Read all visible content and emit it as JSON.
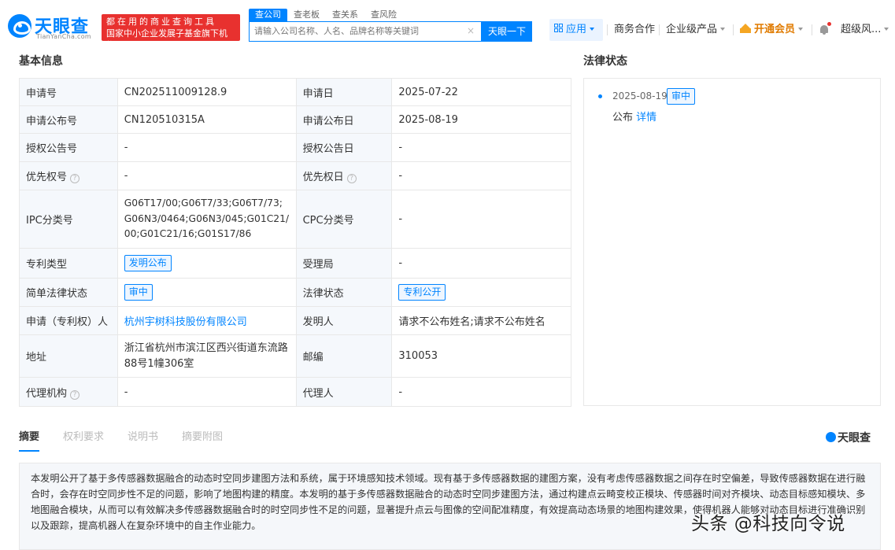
{
  "header": {
    "logo_text": "天眼查",
    "logo_sub": "TianYanCha.com",
    "badge_line1": "都在用的商业查询工具",
    "badge_line2": "国家中小企业发展子基金旗下机构",
    "search_tabs": [
      "查公司",
      "查老板",
      "查关系",
      "查风险"
    ],
    "search_placeholder": "请输入公司名称、人名、品牌名称等关键词",
    "search_clear": "×",
    "search_button": "天眼一下",
    "nav_app": "应用",
    "nav_business": "商务合作",
    "nav_enterprise": "企业级产品",
    "nav_vip": "开通会员",
    "nav_user": "超级风..."
  },
  "basic_info": {
    "title": "基本信息",
    "rows": [
      {
        "l1": "申请号",
        "v1": "CN202511009128.9",
        "l2": "申请日",
        "v2": "2025-07-22"
      },
      {
        "l1": "申请公布号",
        "v1": "CN120510315A",
        "l2": "申请公布日",
        "v2": "2025-08-19"
      },
      {
        "l1": "授权公告号",
        "v1": "-",
        "l2": "授权公告日",
        "v2": "-"
      },
      {
        "l1": "优先权号",
        "v1": "-",
        "l2": "优先权日",
        "v2": "-"
      },
      {
        "l1": "IPC分类号",
        "v1": "G06T17/00;G06T7/33;G06T7/73;G06N3/0464;G06N3/045;G01C21/00;G01C21/16;G01S17/86",
        "l2": "CPC分类号",
        "v2": "-"
      },
      {
        "l1": "专利类型",
        "v1": "发明公布",
        "l2": "受理局",
        "v2": "-"
      },
      {
        "l1": "简单法律状态",
        "v1": "审中",
        "l2": "法律状态",
        "v2": "专利公开"
      },
      {
        "l1": "申请（专利权）人",
        "v1": "杭州宇树科技股份有限公司",
        "l2": "发明人",
        "v2": "请求不公布姓名;请求不公布姓名"
      },
      {
        "l1": "地址",
        "v1": "浙江省杭州市滨江区西兴街道东流路88号1幢306室",
        "l2": "邮编",
        "v2": "310053"
      },
      {
        "l1": "代理机构",
        "v1": "-",
        "l2": "代理人",
        "v2": "-"
      }
    ]
  },
  "legal_status": {
    "title": "法律状态",
    "date": "2025-08-19",
    "tag": "审中",
    "event": "公布",
    "detail_link": "详情"
  },
  "tabs": [
    "摘要",
    "权利要求",
    "说明书",
    "摘要附图"
  ],
  "brand_mark": "天眼查",
  "abstract": "本发明公开了基于多传感器数据融合的动态时空同步建图方法和系统，属于环境感知技术领域。现有基于多传感器数据的建图方案，没有考虑传感器数据之间存在时空偏差，导致传感器数据在进行融合时，会存在时空同步性不足的问题，影响了地图构建的精度。本发明的基于多传感器数据融合的动态时空同步建图方法，通过构建点云畸变校正模块、传感器时间对齐模块、动态目标感知模块、多地图融合模块，从而可以有效解决多传感器数据融合时的时空同步性不足的问题，显著提升点云与图像的空间配准精度，有效提高动态场景的地图构建效果，使得机器人能够对动态目标进行准确识别以及跟踪，提高机器人在复杂环境中的自主作业能力。",
  "watermark": "头条 @科技向令说",
  "help_mark": "?",
  "colors": {
    "accent": "#0084ff",
    "badge_red": "#e8312f",
    "vip_orange": "#f5a623",
    "label_bg": "#f5f8fc"
  }
}
